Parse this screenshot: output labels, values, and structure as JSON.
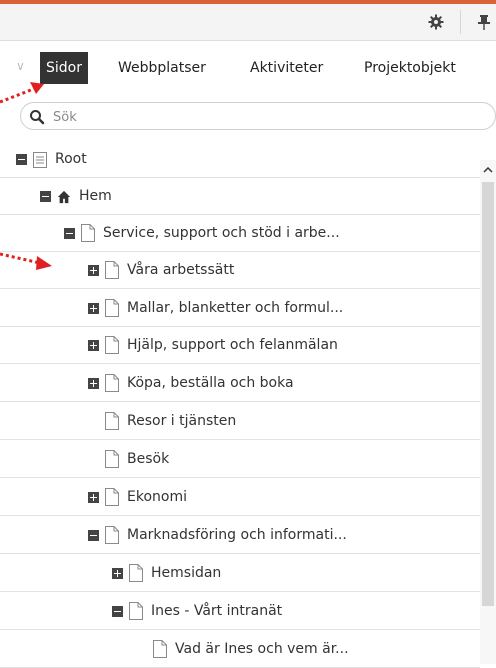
{
  "toolbar": {
    "icons": [
      "gear-icon",
      "pin-icon"
    ]
  },
  "tabs": {
    "items": [
      {
        "label": "Sidor",
        "active": true
      },
      {
        "label": "Webbplatser",
        "active": false
      },
      {
        "label": "Aktiviteter",
        "active": false
      },
      {
        "label": "Projektobjekt",
        "active": false
      }
    ]
  },
  "search": {
    "placeholder": "Sök",
    "value": ""
  },
  "tree": {
    "items": [
      {
        "label": "Root",
        "toggle": "minus",
        "icon": "root-page-icon"
      },
      {
        "label": "Hem",
        "toggle": "minus",
        "icon": "home-icon"
      },
      {
        "label": "Service, support och stöd i arbe...",
        "toggle": "minus",
        "icon": "page-icon"
      },
      {
        "label": "Våra arbetssätt",
        "toggle": "plus",
        "icon": "page-icon"
      },
      {
        "label": "Mallar, blanketter och formul...",
        "toggle": "plus",
        "icon": "page-icon"
      },
      {
        "label": "Hjälp, support och felanmälan",
        "toggle": "plus",
        "icon": "page-icon"
      },
      {
        "label": "Köpa, beställa och boka",
        "toggle": "plus",
        "icon": "page-icon"
      },
      {
        "label": "Resor i tjänsten",
        "toggle": "none",
        "icon": "page-icon"
      },
      {
        "label": "Besök",
        "toggle": "none",
        "icon": "page-icon"
      },
      {
        "label": "Ekonomi",
        "toggle": "plus",
        "icon": "page-icon"
      },
      {
        "label": "Marknadsföring och informati...",
        "toggle": "minus",
        "icon": "page-icon"
      },
      {
        "label": "Hemsidan",
        "toggle": "plus",
        "icon": "page-icon"
      },
      {
        "label": "Ines - Vårt intranät",
        "toggle": "minus",
        "icon": "page-icon"
      },
      {
        "label": "Vad är Ines och vem är...",
        "toggle": "none",
        "icon": "page-icon"
      }
    ]
  },
  "colors": {
    "accent_bar": "#d9643a",
    "active_tab_bg": "#333333",
    "annotation_arrow": "#e02020"
  }
}
